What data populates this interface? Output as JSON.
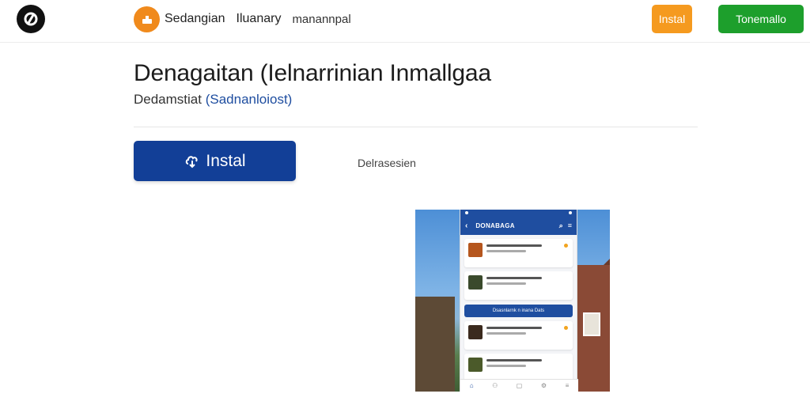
{
  "header": {
    "logo_icon": "brand-logo-icon",
    "app_icon": "app-icon",
    "nav": [
      "Sedangian",
      "Iluanary",
      "manannpal"
    ],
    "orange_button": "Instal",
    "green_button": "Tonemallo"
  },
  "main": {
    "title": "Denagaitan (Ielnarrinian Inmallgaa",
    "subtitle_text": "Dedamstiat",
    "subtitle_link": "(Sadnanloiost)",
    "install_button": "Instal",
    "install_icon": "download-icon",
    "description_link": "Delrasesien"
  },
  "screenshot": {
    "header_title": "DONABAGA",
    "cta_label": "Dsasnlarnk n inana Dats",
    "colors": {
      "brand": "#1f4ea0",
      "accent": "#f2a41f"
    }
  },
  "colors": {
    "install_blue": "#123f97",
    "orange": "#f59a1f",
    "green": "#1d9f2c",
    "link": "#1f4ea0"
  }
}
